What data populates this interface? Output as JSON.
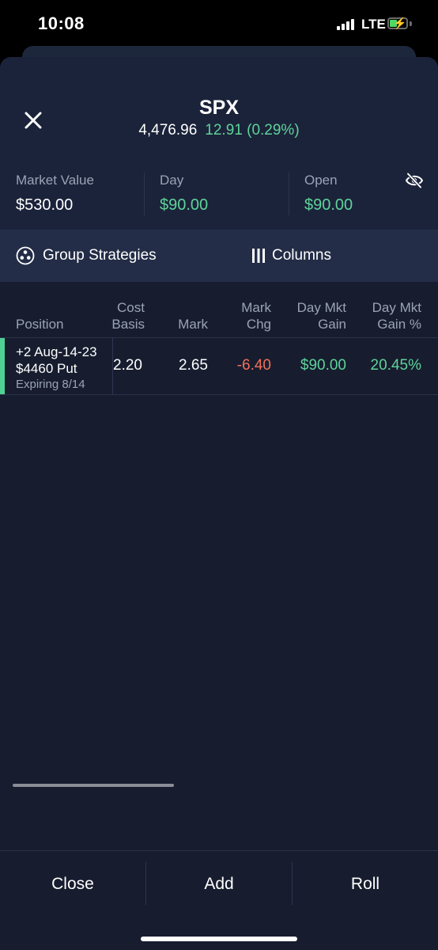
{
  "status_bar": {
    "time": "10:08",
    "network": "LTE",
    "battery_level": 0.45,
    "charging": true
  },
  "header": {
    "symbol": "SPX",
    "price": "4,476.96",
    "change": "12.91 (0.29%)",
    "close_icon": "close-icon"
  },
  "stats": {
    "market_value_label": "Market Value",
    "market_value": "$530.00",
    "day_label": "Day",
    "day_value": "$90.00",
    "open_label": "Open",
    "open_value": "$90.00",
    "visibility_icon": "eye-off-icon"
  },
  "toolbar": {
    "group_strategies_label": "Group Strategies",
    "group_strategies_icon": "strategies-icon",
    "columns_label": "Columns",
    "columns_icon": "columns-icon"
  },
  "table": {
    "headers": {
      "position": "Position",
      "cost_basis_1": "Cost",
      "cost_basis_2": "Basis",
      "mark": "Mark",
      "mark_chg_1": "Mark",
      "mark_chg_2": "Chg",
      "day_mkt_gain_1": "Day Mkt",
      "day_mkt_gain_2": "Gain",
      "day_mkt_gain_pct_1": "Day Mkt",
      "day_mkt_gain_pct_2": "Gain %"
    },
    "rows": [
      {
        "position_line1": "+2 Aug-14-23",
        "position_line2": "$4460 Put",
        "position_sub": "Expiring 8/14",
        "cost_basis": "2.20",
        "mark": "2.65",
        "mark_chg": "-6.40",
        "day_mkt_gain": "$90.00",
        "day_mkt_gain_pct": "20.45%"
      }
    ]
  },
  "actions": {
    "close_label": "Close",
    "add_label": "Add",
    "roll_label": "Roll"
  },
  "colors": {
    "positive": "#5fd39a",
    "negative": "#f0705a",
    "background": "#171d2f",
    "accent": "#4fd196"
  }
}
